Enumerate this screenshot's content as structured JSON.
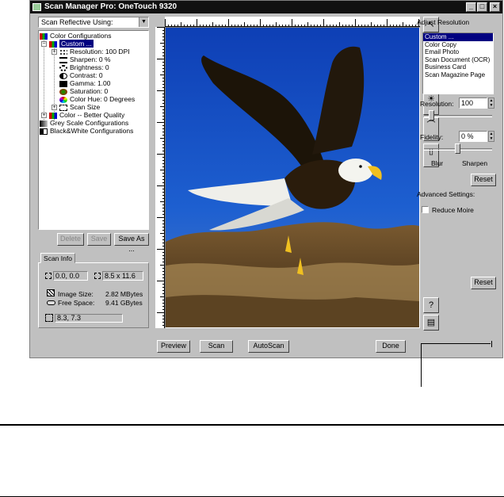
{
  "window": {
    "title": "Scan Manager Pro:  OneTouch 9320"
  },
  "left": {
    "source_dropdown": "Scan Reflective Using:",
    "tree": [
      {
        "label": "Color Configurations"
      },
      {
        "label": "Custom ..."
      },
      {
        "label": "Resolution: 100 DPI"
      },
      {
        "label": "Sharpen: 0 %"
      },
      {
        "label": "Brightness: 0"
      },
      {
        "label": "Contrast: 0"
      },
      {
        "label": "Gamma: 1.00"
      },
      {
        "label": "Saturation: 0"
      },
      {
        "label": "Color Hue: 0 Degrees"
      },
      {
        "label": "Scan Size"
      },
      {
        "label": "Color -- Better Quality"
      },
      {
        "label": "Grey Scale Configurations"
      },
      {
        "label": "Black&White Configurations"
      }
    ],
    "delete_label": "Delete",
    "save_label": "Save",
    "save_as_label": "Save As ..."
  },
  "scan_info": {
    "tab": "Scan Info",
    "origin": "0.0, 0.0",
    "size": "8.5 x 11.6",
    "image_size_label": "Image Size:",
    "image_size_value": "2.82 MBytes",
    "free_space_label": "Free Space:",
    "free_space_value": "9.41 GBytes",
    "cursor": "8.3, 7.3"
  },
  "bottom": {
    "preview": "Preview",
    "scan": "Scan",
    "autoscan": "AutoScan",
    "done": "Done"
  },
  "right": {
    "adjust_heading": "Adjust Resolution",
    "presets": [
      "Custom ...",
      "Color Copy",
      "Email Photo",
      "Scan Document (OCR)",
      "Business Card",
      "Scan Magazine Page"
    ],
    "resolution_label": "Resolution:",
    "resolution_value": "100",
    "resolution_fraction": 0.12,
    "fidelity_label": "Fidelity:",
    "fidelity_value": "0 %",
    "fidelity_fraction": 0.5,
    "blur_label": "Blur",
    "sharpen_label": "Sharpen",
    "reset_label": "Reset",
    "advanced_label": "Advanced Settings:",
    "reduce_moire_label": "Reduce Moire",
    "reset2_label": "Reset"
  },
  "colors": {
    "selection": "#000080",
    "window_bg": "#c0c0c0",
    "sky": "#1d5fd0"
  }
}
